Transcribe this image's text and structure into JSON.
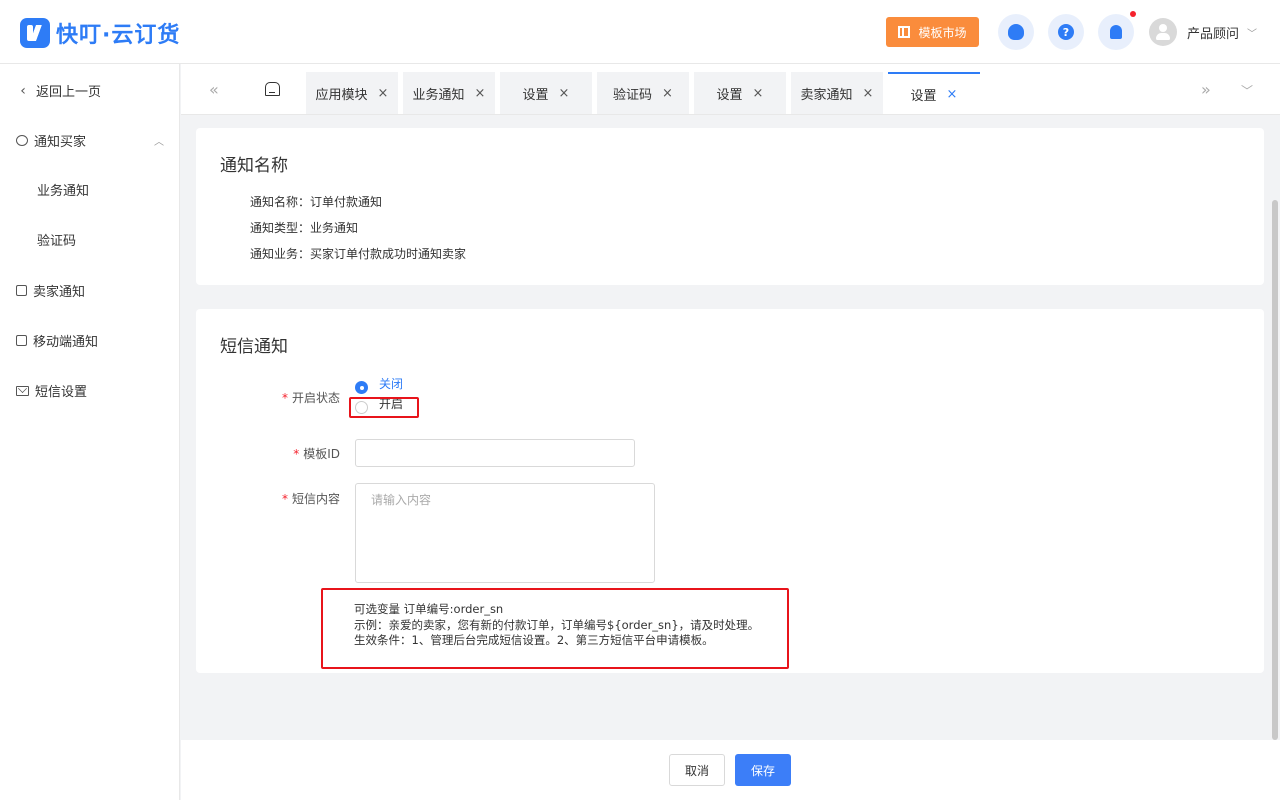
{
  "app": {
    "brand": "快叮·云订货"
  },
  "header": {
    "market_label": "模板市场",
    "user_name": "产品顾问",
    "help_glyph": "?"
  },
  "sidebar": {
    "back_label": "返回上一页",
    "items": [
      {
        "label": "通知买家",
        "icon": "chat-icon"
      },
      {
        "label": "业务通知"
      },
      {
        "label": "验证码"
      },
      {
        "label": "卖家通知",
        "icon": "seller-icon"
      },
      {
        "label": "移动端通知",
        "icon": "mobile-notify-icon"
      },
      {
        "label": "短信设置",
        "icon": "mail-icon"
      }
    ]
  },
  "tabs": [
    {
      "label": "应用模块"
    },
    {
      "label": "业务通知"
    },
    {
      "label": "设置"
    },
    {
      "label": "验证码"
    },
    {
      "label": "设置"
    },
    {
      "label": "卖家通知"
    },
    {
      "label": "设置",
      "active": true
    }
  ],
  "notify_card": {
    "title": "通知名称",
    "fields": [
      {
        "label": "通知名称：",
        "value": "订单付款通知"
      },
      {
        "label": "通知类型：",
        "value": "业务通知"
      },
      {
        "label": "通知业务：",
        "value": "买家订单付款成功时通知卖家"
      }
    ]
  },
  "sms_card": {
    "title": "短信通知",
    "status_label": "开启状态",
    "status_options": [
      {
        "label": "关闭",
        "selected": true
      },
      {
        "label": "开启",
        "selected": false
      }
    ],
    "template_label": "模板ID",
    "template_value": "",
    "content_label": "短信内容",
    "content_placeholder": "请输入内容",
    "hints": [
      "可选变量 订单编号:order_sn",
      "示例：亲爱的卖家，您有新的付款订单，订单编号${order_sn}，请及时处理。",
      "生效条件：1、管理后台完成短信设置。2、第三方短信平台申请模板。"
    ],
    "required_mark": "*"
  },
  "footer": {
    "cancel_label": "取消",
    "save_label": "保存"
  },
  "colors": {
    "primary": "#2e7cf6",
    "accent_orange": "#fa8c3c",
    "highlight_red": "#e8141b"
  }
}
